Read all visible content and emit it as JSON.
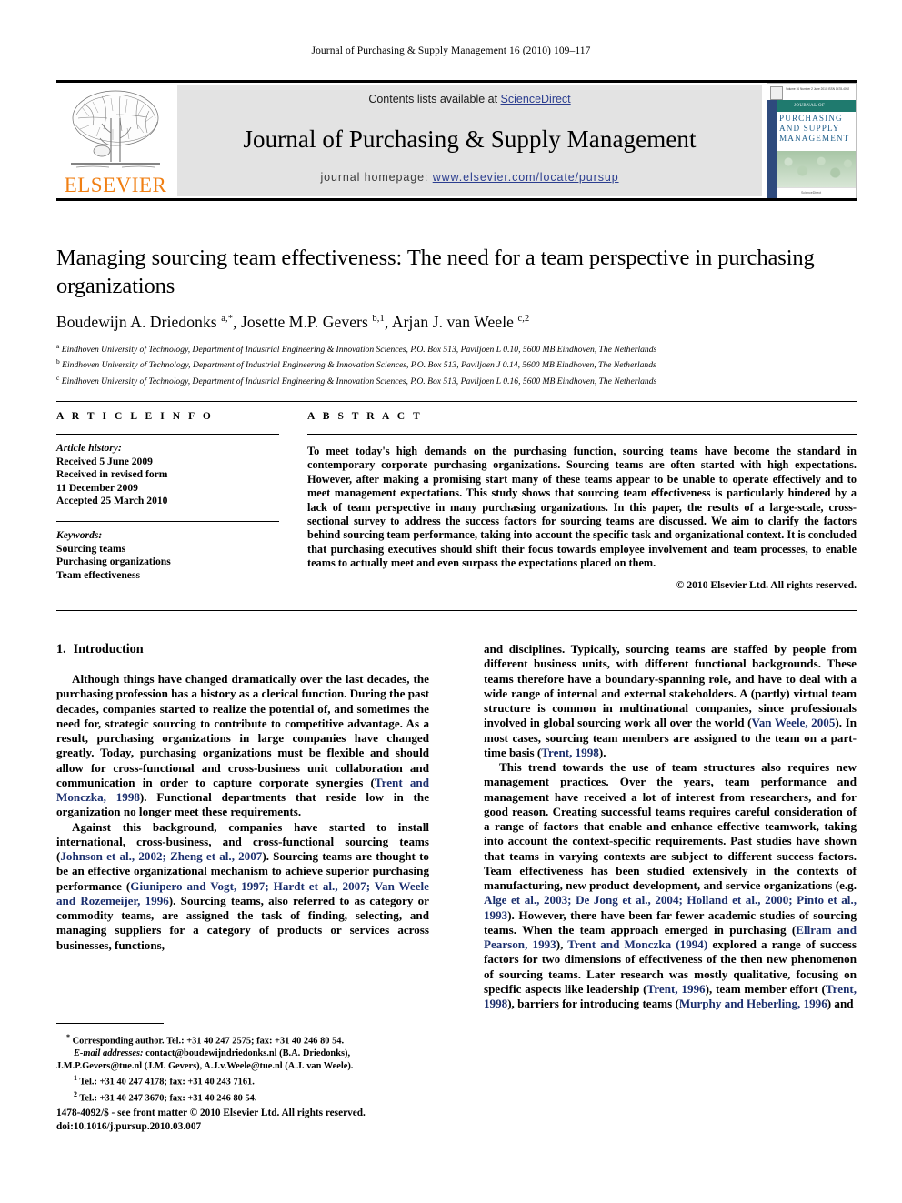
{
  "running_head": "Journal of Purchasing & Supply Management 16 (2010) 109–117",
  "masthead": {
    "publisher": "ELSEVIER",
    "contents_prefix": "Contents lists available at ",
    "contents_link": "ScienceDirect",
    "journal_title": "Journal of Purchasing & Supply Management",
    "homepage_prefix": "journal homepage: ",
    "homepage_url": "www.elsevier.com/locate/pursup",
    "cover": {
      "top_meta": "Volume 16   Number 2   June 2010   ISSN 1478-4092",
      "banner": "JOURNAL OF",
      "title_line1": "PURCHASING",
      "title_line2": "AND SUPPLY",
      "title_line3": "MANAGEMENT",
      "footer": "ScienceDirect"
    }
  },
  "article": {
    "title": "Managing sourcing team effectiveness: The need for a team perspective in purchasing organizations",
    "authors_html": "Boudewijn A. Driedonks <sup>a,</sup><sup>*</sup>, Josette M.P. Gevers <sup>b,1</sup>, Arjan J. van Weele <sup>c,2</sup>",
    "affiliations": [
      {
        "marker": "a",
        "text": "Eindhoven University of Technology, Department of Industrial Engineering & Innovation Sciences, P.O. Box 513, Paviljoen L 0.10, 5600 MB Eindhoven, The Netherlands"
      },
      {
        "marker": "b",
        "text": "Eindhoven University of Technology, Department of Industrial Engineering & Innovation Sciences, P.O. Box 513, Paviljoen J 0.14, 5600 MB Eindhoven, The Netherlands"
      },
      {
        "marker": "c",
        "text": "Eindhoven University of Technology, Department of Industrial Engineering & Innovation Sciences, P.O. Box 513, Paviljoen L 0.16, 5600 MB Eindhoven, The Netherlands"
      }
    ]
  },
  "article_info": {
    "heading": "A R T I C L E  I N F O",
    "history_label": "Article history:",
    "history_lines": [
      "Received 5 June 2009",
      "Received in revised form",
      "11 December 2009",
      "Accepted 25 March 2010"
    ],
    "keywords_label": "Keywords:",
    "keywords": [
      "Sourcing teams",
      "Purchasing organizations",
      "Team effectiveness"
    ]
  },
  "abstract": {
    "heading": "A B S T R A C T",
    "text": "To meet today's high demands on the purchasing function, sourcing teams have become the standard in contemporary corporate purchasing organizations. Sourcing teams are often started with high expectations. However, after making a promising start many of these teams appear to be unable to operate effectively and to meet management expectations. This study shows that sourcing team effectiveness is particularly hindered by a lack of team perspective in many purchasing organizations. In this paper, the results of a large-scale, cross-sectional survey to address the success factors for sourcing teams are discussed. We aim to clarify the factors behind sourcing team performance, taking into account the specific task and organizational context. It is concluded that purchasing executives should shift their focus towards employee involvement and team processes, to enable teams to actually meet and even surpass the expectations placed on them.",
    "copyright": "© 2010 Elsevier Ltd. All rights reserved."
  },
  "body": {
    "section_number": "1.",
    "section_title": "Introduction",
    "left_paragraphs": [
      "Although things have changed dramatically over the last decades, the purchasing profession has a history as a clerical function. During the past decades, companies started to realize the potential of, and sometimes the need for, strategic sourcing to contribute to competitive advantage. As a result, purchasing organizations in large companies have changed greatly. Today, purchasing organizations must be flexible and should allow for cross-functional and cross-business unit collaboration and communication in order to capture corporate synergies (@Trent and Monczka, 1998@). Functional departments that reside low in the organization no longer meet these requirements.",
      "Against this background, companies have started to install international, cross-business, and cross-functional sourcing teams (@Johnson et al., 2002; Zheng et al., 2007@). Sourcing teams are thought to be an effective organizational mechanism to achieve superior purchasing performance (@Giunipero and Vogt, 1997; Hardt et al., 2007; Van Weele and Rozemeijer, 1996@). Sourcing teams, also referred to as category or commodity teams, are assigned the task of finding, selecting, and managing suppliers for a category of products or services across businesses, functions,"
    ],
    "right_paragraphs": [
      "and disciplines. Typically, sourcing teams are staffed by people from different business units, with different functional backgrounds. These teams therefore have a boundary-spanning role, and have to deal with a wide range of internal and external stakeholders. A (partly) virtual team structure is common in multinational companies, since professionals involved in global sourcing work all over the world (@Van Weele, 2005@). In most cases, sourcing team members are assigned to the team on a part-time basis (@Trent, 1998@).",
      "This trend towards the use of team structures also requires new management practices. Over the years, team performance and management have received a lot of interest from researchers, and for good reason. Creating successful teams requires careful consideration of a range of factors that enable and enhance effective teamwork, taking into account the context-specific requirements. Past studies have shown that teams in varying contexts are subject to different success factors. Team effectiveness has been studied extensively in the contexts of manufacturing, new product development, and service organizations (e.g. @Alge et al., 2003; De Jong et al., 2004; Holland et al., 2000; Pinto et al., 1993@). However, there have been far fewer academic studies of sourcing teams. When the team approach emerged in purchasing (@Ellram and Pearson, 1993@), @Trent and Monczka (1994)@ explored a range of success factors for two dimensions of effectiveness of the then new phenomenon of sourcing teams. Later research was mostly qualitative, focusing on specific aspects like leadership (@Trent, 1996@), team member effort (@Trent, 1998@), barriers for introducing teams (@Murphy and Heberling, 1996@) and"
    ]
  },
  "footnotes": {
    "corresponding": "Corresponding author. Tel.: +31 40 247 2575; fax: +31 40 246 80 54.",
    "email_label": "E-mail addresses:",
    "email_line1": " contact@boudewijndriedonks.nl (B.A. Driedonks),",
    "email_line2": "J.M.P.Gevers@tue.nl (J.M. Gevers), A.J.v.Weele@tue.nl (A.J. van Weele).",
    "note1": "Tel.: +31 40 247 4178; fax: +31 40 243 7161.",
    "note2": "Tel.: +31 40 247 3670; fax: +31 40 246 80 54."
  },
  "imprint": {
    "line1": "1478-4092/$ - see front matter © 2010 Elsevier Ltd. All rights reserved.",
    "line2": "doi:10.1016/j.pursup.2010.03.007"
  },
  "colors": {
    "link": "#2b3d8f",
    "reference": "#1b2f6e",
    "elsevier_orange": "#F07F13",
    "band_gray": "#e3e3e3"
  }
}
